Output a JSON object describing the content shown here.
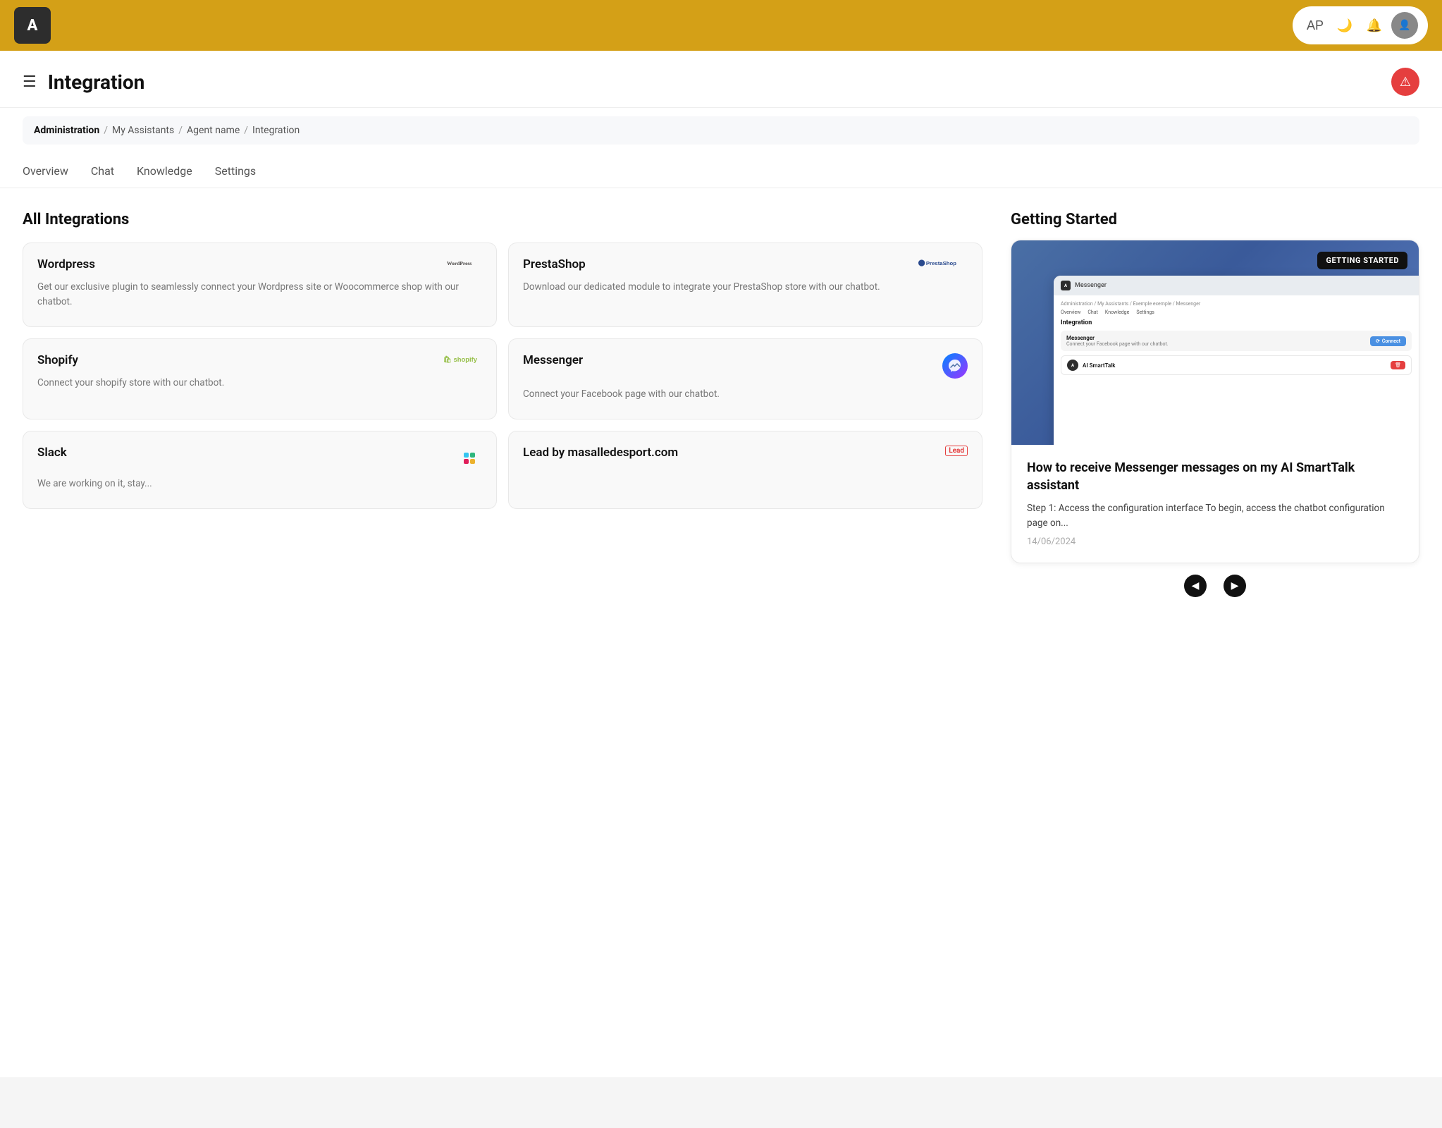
{
  "navbar": {
    "logo_text": "A",
    "icons": [
      "AP",
      "🌙",
      "🔔"
    ]
  },
  "page_header": {
    "title": "Integration",
    "hamburger": "☰"
  },
  "breadcrumb": {
    "items": [
      "Administration",
      "My Assistants",
      "Agent name",
      "Integration"
    ],
    "separators": [
      "/",
      "/",
      "/"
    ]
  },
  "tabs": {
    "items": [
      "Overview",
      "Chat",
      "Knowledge",
      "Settings"
    ]
  },
  "integrations": {
    "section_title": "All Integrations",
    "cards": [
      {
        "name": "Wordpress",
        "logo": "WordPress",
        "logo_type": "wp",
        "description": "Get our exclusive plugin to seamlessly connect your Wordpress site or Woocommerce shop with our chatbot."
      },
      {
        "name": "PrestaShop",
        "logo": "PrestaShop",
        "logo_type": "presta",
        "description": "Download our dedicated module to integrate your PrestaShop store with our chatbot."
      },
      {
        "name": "Shopify",
        "logo": "Shopify",
        "logo_type": "shopify",
        "description": "Connect your shopify store with our chatbot."
      },
      {
        "name": "Messenger",
        "logo": "messenger",
        "logo_type": "messenger",
        "description": "Connect your Facebook page with our chatbot."
      },
      {
        "name": "Slack",
        "logo": "slack",
        "logo_type": "slack",
        "description": "We are working on it, stay..."
      },
      {
        "name": "Lead by masalledesport.com",
        "logo": "Lead",
        "logo_type": "lead",
        "description": ""
      }
    ]
  },
  "getting_started": {
    "section_title": "Getting Started",
    "badge": "GETTING STARTED",
    "article_title": "How to receive Messenger messages on my AI SmartTalk assistant",
    "article_excerpt": "Step 1: Access the configuration interface\nTo begin, access the chatbot configuration page on...",
    "article_date": "14/06/2024",
    "mock_ui": {
      "breadcrumb": "Administration / My Assistants / Exemple exemple / Messenger",
      "nav_items": [
        "Overview",
        "Chat",
        "Knowledge",
        "Settings"
      ],
      "section_title": "Integration",
      "integration_name": "Messenger",
      "integration_desc": "Connect your Facebook page with our chatbot.",
      "connect_label": "Connect",
      "chat_name": "AI SmartTalk"
    }
  },
  "pagination": {
    "prev": "◀",
    "next": "▶"
  }
}
